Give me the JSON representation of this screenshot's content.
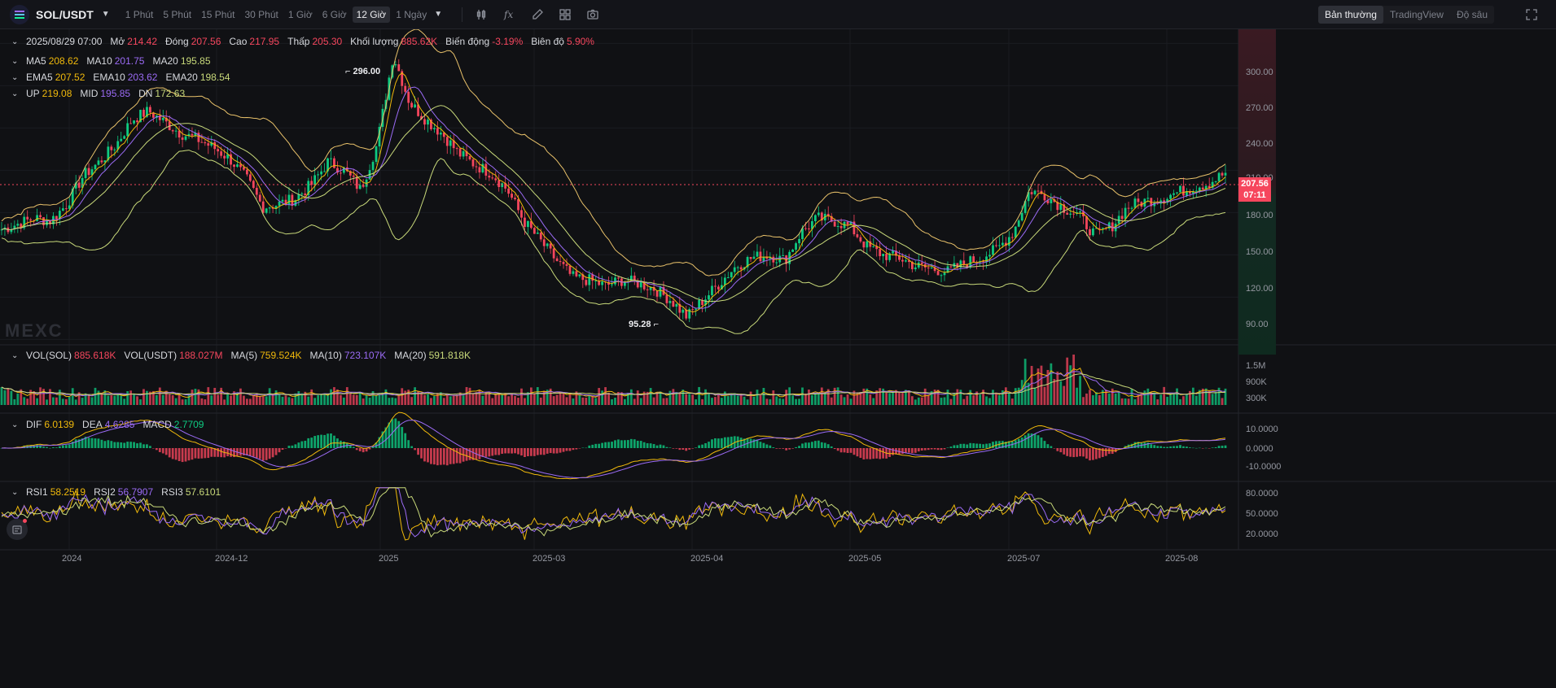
{
  "toolbar": {
    "pair": "SOL/USDT",
    "intervals": [
      "1 Phút",
      "5 Phút",
      "15 Phút",
      "30 Phút",
      "1 Giờ",
      "6 Giờ",
      "12 Giờ",
      "1 Ngày"
    ],
    "active_interval": "12 Giờ",
    "views": [
      "Bản thường",
      "TradingView",
      "Độ sâu"
    ],
    "active_view": "Bản thường",
    "tool_icons": [
      "indicator-icon",
      "formula-icon",
      "draw-icon",
      "layout-icon",
      "camera-icon"
    ]
  },
  "colors": {
    "up": "#0ecb81",
    "down": "#f6465d",
    "ma5": "#f0b90b",
    "ma10": "#9b6bf5",
    "ma20": "#c8d97a",
    "boll": "#e8c16a",
    "bg": "#101114"
  },
  "ohlc": {
    "date": "2025/08/29 07:00",
    "open_label": "Mở",
    "open": "214.42",
    "close_label": "Đóng",
    "close": "207.56",
    "high_label": "Cao",
    "high": "217.95",
    "low_label": "Thấp",
    "low": "205.30",
    "volume_label": "Khối lượng",
    "volume": "885.62K",
    "change_label": "Biến động",
    "change": "-3.19%",
    "amplitude_label": "Biên độ",
    "amplitude": "5.90%"
  },
  "ma": {
    "ma5_label": "MA5",
    "ma5": "208.62",
    "ma10_label": "MA10",
    "ma10": "201.75",
    "ma20_label": "MA20",
    "ma20": "195.85"
  },
  "ema": {
    "ema5_label": "EMA5",
    "ema5": "207.52",
    "ema10_label": "EMA10",
    "ema10": "203.62",
    "ema20_label": "EMA20",
    "ema20": "198.54"
  },
  "boll": {
    "up_label": "UP",
    "up": "219.08",
    "mid_label": "MID",
    "mid": "195.85",
    "dn_label": "DN",
    "dn": "172.63"
  },
  "volume": {
    "vol_sol_label": "VOL(SOL)",
    "vol_sol": "885.618K",
    "vol_usdt_label": "VOL(USDT)",
    "vol_usdt": "188.027M",
    "ma5_label": "MA(5)",
    "ma5": "759.524K",
    "ma10_label": "MA(10)",
    "ma10": "723.107K",
    "ma20_label": "MA(20)",
    "ma20": "591.818K"
  },
  "macd": {
    "dif_label": "DIF",
    "dif": "6.0139",
    "dea_label": "DEA",
    "dea": "4.6285",
    "macd_label": "MACD",
    "macd": "2.7709"
  },
  "rsi": {
    "rsi1_label": "RSI1",
    "rsi1": "58.2519",
    "rsi2_label": "RSI2",
    "rsi2": "56.7907",
    "rsi3_label": "RSI3",
    "rsi3": "57.6101"
  },
  "price_axis": [
    "300.00",
    "270.00",
    "240.00",
    "210.00",
    "180.00",
    "150.00",
    "120.00",
    "90.00"
  ],
  "volume_axis": [
    "1.5M",
    "900K",
    "300K"
  ],
  "macd_axis": [
    "10.0000",
    "0.0000",
    "-10.0000"
  ],
  "rsi_axis": [
    "80.0000",
    "50.0000",
    "20.0000"
  ],
  "last_price": {
    "price": "207.56",
    "countdown": "07:11"
  },
  "high_marker": "296.00",
  "low_marker": "95.28",
  "watermark": "MEXC",
  "time_axis": [
    "2024",
    "2024-12",
    "2025",
    "2025-03",
    "2025-04",
    "2025-05",
    "2025-07",
    "2025-08"
  ],
  "chart_data": {
    "type": "line",
    "title": "",
    "series": [
      {
        "values": [
          168,
          172,
          176,
          174,
          186,
          206,
          216,
          228,
          246,
          252,
          244,
          236,
          232,
          226,
          218,
          204,
          184,
          186,
          190,
          200,
          216,
          210,
          196,
          228,
          292,
          258,
          246,
          236,
          222,
          214,
          208,
          196,
          174,
          160,
          146,
          134,
          132,
          128,
          132,
          130,
          126,
          118,
          106,
          118,
          130,
          142,
          148,
          150,
          146,
          166,
          176,
          174,
          170,
          156,
          150,
          148,
          142,
          140,
          138,
          144,
          148,
          154,
          166,
          196,
          192,
          184,
          178,
          164,
          170,
          184,
          188,
          190,
          194,
          198,
          201,
          208
        ]
      }
    ],
    "ylim": [
      85,
      310
    ],
    "xlabel": "",
    "ylabel": ""
  }
}
